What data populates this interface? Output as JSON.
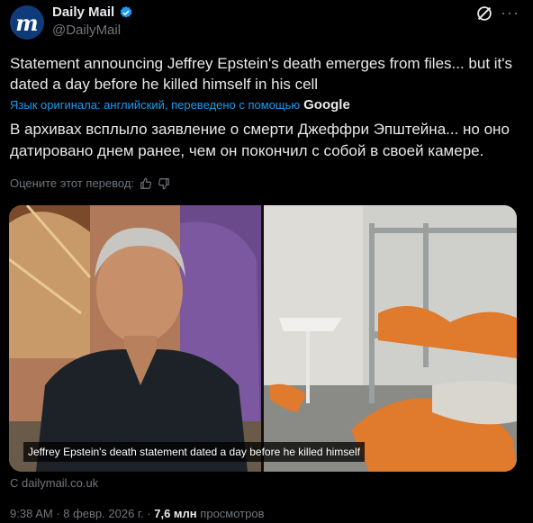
{
  "author": {
    "display_name": "Daily Mail",
    "handle": "@DailyMail",
    "avatar_letter": "m"
  },
  "tweet": {
    "text": "Statement announcing Jeffrey Epstein's death emerges from files... but it's dated a day before he killed himself in his cell",
    "translation_info": "Язык оригинала: английский, переведено с помощью",
    "translation_provider": "Google",
    "translated_text": "В архивах всплыло заявление о смерти Джеффри Эпштейна... но оно датировано днем ранее, чем он покончил с собой в своей камере.",
    "rate_translation": "Оцените этот перевод:"
  },
  "card": {
    "caption": "Jeffrey Epstein's death statement dated a day before he killed himself",
    "source": "С dailymail.co.uk"
  },
  "meta": {
    "time_date": "9:38 AM · 8 февр. 2026 г. ·",
    "views_count": "7,6 млн",
    "views_label": "просмотров"
  },
  "colors": {
    "background": "#000000",
    "text": "#e7e9ea",
    "secondary": "#71767b",
    "link": "#1d9bf0"
  },
  "icons": [
    "verified-badge-icon",
    "grok-icon",
    "more-icon",
    "thumbs-up-icon",
    "thumbs-down-icon"
  ]
}
